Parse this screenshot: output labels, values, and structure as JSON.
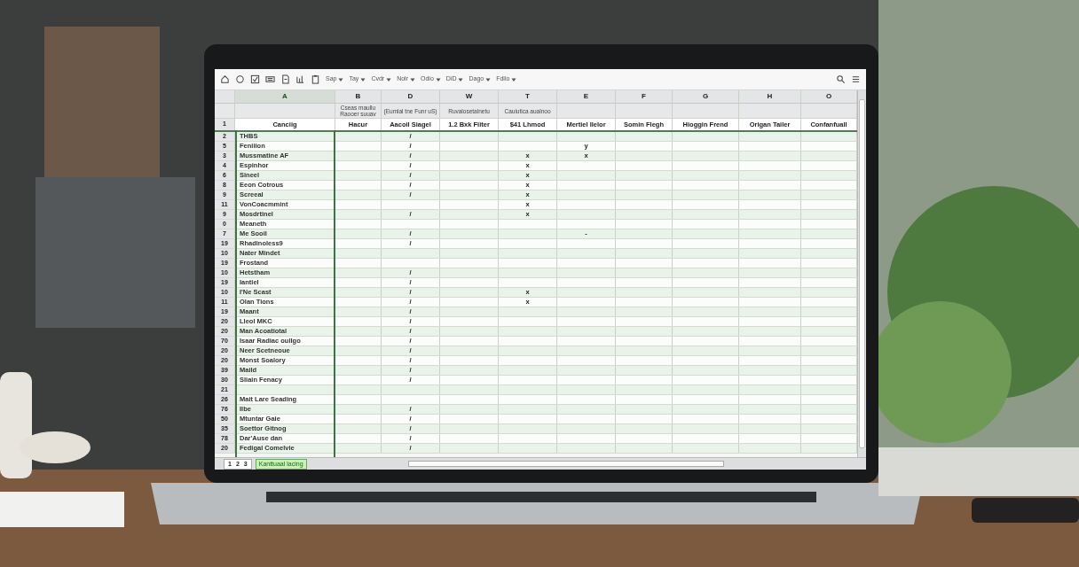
{
  "toolbar": {
    "menus": [
      "Sap",
      "Tay",
      "Cvdr",
      "Nolr",
      "Odio",
      "DiD",
      "Dago",
      "Fdilo"
    ]
  },
  "heading_row_number": "1",
  "columns": [
    {
      "letter": "A",
      "heading": "Canciig",
      "selected": true
    },
    {
      "letter": "B",
      "subtitle": "Cseas maullu Raooer suuav",
      "heading": "Hacur",
      "selected": false
    },
    {
      "letter": "D",
      "subtitle": "(Eumlal tne Funr uS)",
      "heading": "Aacoil Siagel",
      "selected": false
    },
    {
      "letter": "W",
      "subtitle": "Ruvalosetalnetu",
      "heading": "1.2 Bxk Fiiter",
      "selected": false
    },
    {
      "letter": "T",
      "subtitle": "Cauiutica aualnoo",
      "heading": "$41 Lhmod",
      "selected": false
    },
    {
      "letter": "E",
      "heading": "Mertiel Ilelor",
      "selected": false
    },
    {
      "letter": "F",
      "heading": "Somin Flegh",
      "selected": false
    },
    {
      "letter": "G",
      "heading": "Hioggin Frend",
      "selected": false
    },
    {
      "letter": "H",
      "heading": "Origan Tailer",
      "selected": false
    },
    {
      "letter": "O",
      "heading": "Confanfuall",
      "selected": false
    }
  ],
  "rows": [
    {
      "number": "2",
      "name": "THBS",
      "marks": {
        "D": "/"
      }
    },
    {
      "number": "5",
      "name": "Feniiion",
      "marks": {
        "D": "/",
        "E": "y"
      }
    },
    {
      "number": "3",
      "name": "Mussmatine AF",
      "marks": {
        "D": "/",
        "T": "x",
        "E": "x"
      }
    },
    {
      "number": "4",
      "name": "Espinhor",
      "marks": {
        "D": "/",
        "T": "x"
      }
    },
    {
      "number": "6",
      "name": "Sineel",
      "marks": {
        "D": "/",
        "T": "x"
      }
    },
    {
      "number": "8",
      "name": "Eeon Cotrous",
      "marks": {
        "D": "/",
        "T": "x"
      }
    },
    {
      "number": "9",
      "name": "Screeal",
      "marks": {
        "D": "/",
        "T": "x"
      }
    },
    {
      "number": "11",
      "name": "VonCoacmmint",
      "marks": {
        "T": "x"
      }
    },
    {
      "number": "9",
      "name": "Mosdrtinel",
      "marks": {
        "D": "/",
        "T": "x"
      }
    },
    {
      "number": "0",
      "name": "Meaneth",
      "marks": {}
    },
    {
      "number": "7",
      "name": "Me Sooil",
      "marks": {
        "D": "/",
        "E": "-"
      }
    },
    {
      "number": "19",
      "name": "Rhadinoless9",
      "marks": {
        "D": "/"
      }
    },
    {
      "number": "10",
      "name": "Nater Mindet",
      "marks": {}
    },
    {
      "number": "19",
      "name": "Frostand",
      "marks": {}
    },
    {
      "number": "10",
      "name": "Hetstham",
      "marks": {
        "D": "/"
      }
    },
    {
      "number": "19",
      "name": "Iantiel",
      "marks": {
        "D": "/"
      }
    },
    {
      "number": "10",
      "name": "I'Ne Scast",
      "marks": {
        "D": "/",
        "T": "x"
      }
    },
    {
      "number": "11",
      "name": "Olan Tions",
      "marks": {
        "D": "/",
        "T": "x"
      }
    },
    {
      "number": "19",
      "name": "Maant",
      "marks": {
        "D": "/"
      }
    },
    {
      "number": "20",
      "name": "Lleol MKC",
      "marks": {
        "D": "/"
      }
    },
    {
      "number": "20",
      "name": "Man Acoatiotal",
      "marks": {
        "D": "/"
      }
    },
    {
      "number": "70",
      "name": "Isaar Radiac oulIgo",
      "marks": {
        "D": "/"
      }
    },
    {
      "number": "20",
      "name": "Neer Scetneoue",
      "marks": {
        "D": "/"
      }
    },
    {
      "number": "20",
      "name": "Monst Soalory",
      "marks": {
        "D": "/"
      }
    },
    {
      "number": "39",
      "name": "Maild",
      "marks": {
        "D": "/"
      }
    },
    {
      "number": "30",
      "name": "Sliain Fenacy",
      "marks": {
        "D": "/"
      }
    },
    {
      "number": "21",
      "marks": {}
    },
    {
      "number": "26",
      "name": "Mait Lare Seading",
      "marks": {}
    },
    {
      "number": "76",
      "name": "Ilbe",
      "marks": {
        "D": "/"
      }
    },
    {
      "number": "50",
      "name": "Mtuntar Gaie",
      "marks": {
        "D": "/"
      }
    },
    {
      "number": "35",
      "name": "Soettor Gitnog",
      "marks": {
        "D": "/"
      }
    },
    {
      "number": "78",
      "name": "Dar'Ause dan",
      "marks": {
        "D": "/"
      }
    },
    {
      "number": "20",
      "name": "Fedigal Comelvie",
      "marks": {
        "D": "/"
      }
    }
  ],
  "sheet_bar": {
    "pages": [
      "1",
      "2",
      "3"
    ],
    "tabs": [
      {
        "label": "Kanttuaal lacing",
        "selected": true
      }
    ]
  }
}
